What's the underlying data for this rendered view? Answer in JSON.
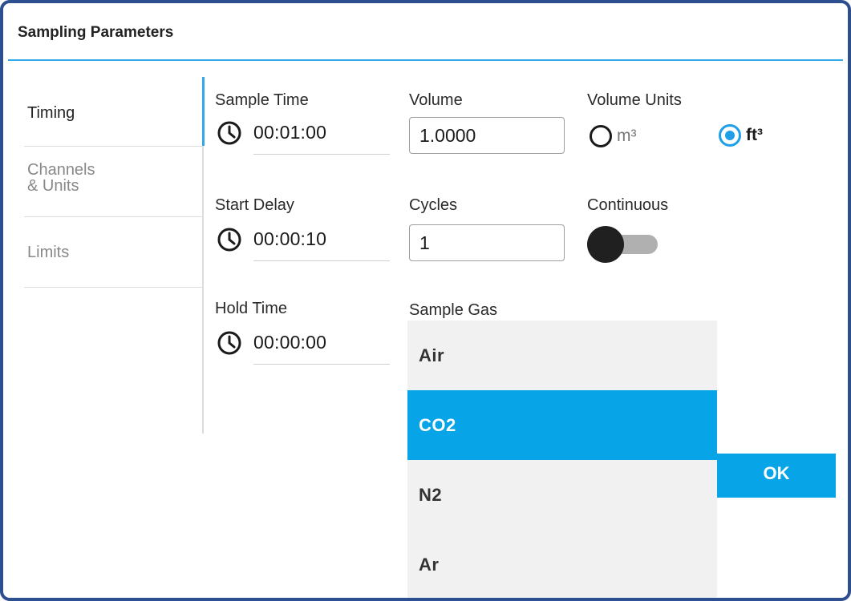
{
  "dialog": {
    "title": "Sampling Parameters"
  },
  "sidebar": {
    "items": [
      {
        "label": "Timing",
        "active": true
      },
      {
        "label": "Channels\n& Units",
        "active": false
      },
      {
        "label": "Limits",
        "active": false
      }
    ]
  },
  "timing": {
    "sample_time": {
      "label": "Sample Time",
      "value": "00:01:00"
    },
    "start_delay": {
      "label": "Start Delay",
      "value": "00:00:10"
    },
    "hold_time": {
      "label": "Hold Time",
      "value": "00:00:00"
    }
  },
  "volume": {
    "label": "Volume",
    "value": "1.0000"
  },
  "cycles": {
    "label": "Cycles",
    "value": "1"
  },
  "volume_units": {
    "label": "Volume Units",
    "options": [
      {
        "label": "m³",
        "checked": false
      },
      {
        "label": "ft³",
        "checked": true
      }
    ]
  },
  "continuous": {
    "label": "Continuous",
    "enabled": false
  },
  "sample_gas": {
    "label": "Sample Gas",
    "selected": "CO2",
    "options": [
      "Air",
      "CO2",
      "N2",
      "Ar"
    ]
  },
  "ok_button": {
    "label": "OK"
  },
  "colors": {
    "accent": "#07a4e8",
    "dialog_border": "#2e4f8f",
    "title_rule": "#33aae8"
  },
  "icons": {
    "clock": "clock-icon"
  }
}
